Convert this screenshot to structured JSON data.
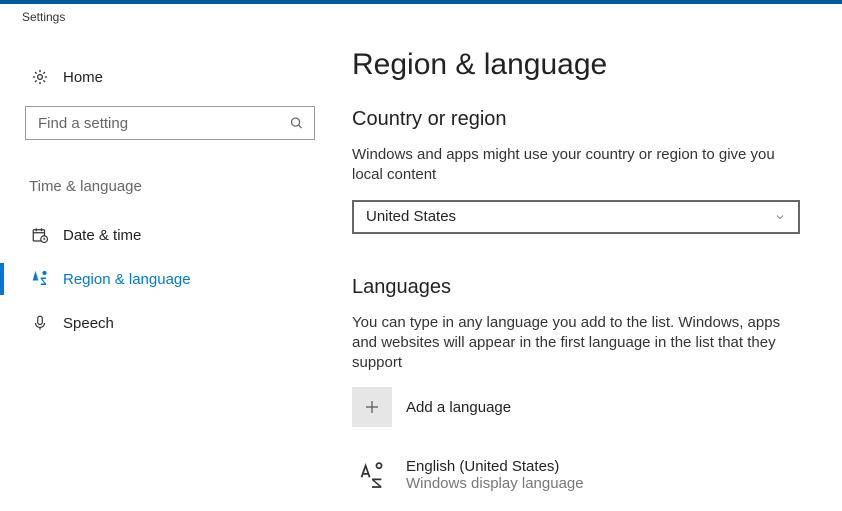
{
  "titlebar": {
    "title": "Settings"
  },
  "sidebar": {
    "home_label": "Home",
    "search_placeholder": "Find a setting",
    "category": "Time & language",
    "items": [
      {
        "label": "Date & time"
      },
      {
        "label": "Region & language"
      },
      {
        "label": "Speech"
      }
    ]
  },
  "main": {
    "page_title": "Region & language",
    "country_section": {
      "title": "Country or region",
      "desc": "Windows and apps might use your country or region to give you local content",
      "selected": "United States"
    },
    "languages_section": {
      "title": "Languages",
      "desc": "You can type in any language you add to the list. Windows, apps and websites will appear in the first language in the list that they support",
      "add_label": "Add a language",
      "items": [
        {
          "name": "English (United States)",
          "sub": "Windows display language"
        }
      ]
    }
  }
}
